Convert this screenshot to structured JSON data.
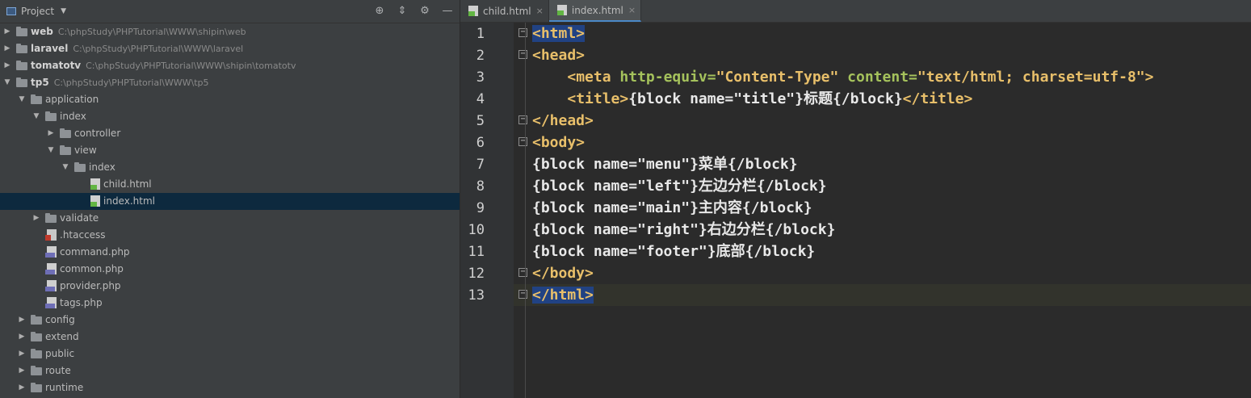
{
  "project": {
    "title": "Project",
    "tree": [
      {
        "label": "web",
        "path": "C:\\phpStudy\\PHPTutorial\\WWW\\shipin\\web",
        "depth": 0,
        "kind": "folder",
        "expanded": false,
        "bold": true
      },
      {
        "label": "laravel",
        "path": "C:\\phpStudy\\PHPTutorial\\WWW\\laravel",
        "depth": 0,
        "kind": "folder",
        "expanded": false,
        "bold": true
      },
      {
        "label": "tomatotv",
        "path": "C:\\phpStudy\\PHPTutorial\\WWW\\shipin\\tomatotv",
        "depth": 0,
        "kind": "folder",
        "expanded": false,
        "bold": true
      },
      {
        "label": "tp5",
        "path": "C:\\phpStudy\\PHPTutorial\\WWW\\tp5",
        "depth": 0,
        "kind": "folder",
        "expanded": true,
        "bold": true
      },
      {
        "label": "application",
        "path": "",
        "depth": 1,
        "kind": "folder",
        "expanded": true
      },
      {
        "label": "index",
        "path": "",
        "depth": 2,
        "kind": "folder",
        "expanded": true
      },
      {
        "label": "controller",
        "path": "",
        "depth": 3,
        "kind": "folder",
        "expanded": false
      },
      {
        "label": "view",
        "path": "",
        "depth": 3,
        "kind": "folder",
        "expanded": true
      },
      {
        "label": "index",
        "path": "",
        "depth": 4,
        "kind": "folder",
        "expanded": true
      },
      {
        "label": "child.html",
        "path": "",
        "depth": 5,
        "kind": "html"
      },
      {
        "label": "index.html",
        "path": "",
        "depth": 5,
        "kind": "html",
        "selected": true
      },
      {
        "label": "validate",
        "path": "",
        "depth": 2,
        "kind": "folder",
        "expanded": false
      },
      {
        "label": ".htaccess",
        "path": "",
        "depth": 2,
        "kind": "ht"
      },
      {
        "label": "command.php",
        "path": "",
        "depth": 2,
        "kind": "php"
      },
      {
        "label": "common.php",
        "path": "",
        "depth": 2,
        "kind": "php"
      },
      {
        "label": "provider.php",
        "path": "",
        "depth": 2,
        "kind": "php"
      },
      {
        "label": "tags.php",
        "path": "",
        "depth": 2,
        "kind": "php"
      },
      {
        "label": "config",
        "path": "",
        "depth": 1,
        "kind": "folder",
        "expanded": false
      },
      {
        "label": "extend",
        "path": "",
        "depth": 1,
        "kind": "folder",
        "expanded": false
      },
      {
        "label": "public",
        "path": "",
        "depth": 1,
        "kind": "folder",
        "expanded": false
      },
      {
        "label": "route",
        "path": "",
        "depth": 1,
        "kind": "folder",
        "expanded": false
      },
      {
        "label": "runtime",
        "path": "",
        "depth": 1,
        "kind": "folder",
        "expanded": false
      }
    ]
  },
  "editor": {
    "tabs": [
      {
        "label": "child.html",
        "active": false
      },
      {
        "label": "index.html",
        "active": true
      }
    ],
    "current_line": 13,
    "lines": [
      {
        "n": "1",
        "fold": true,
        "segments": [
          {
            "c": "sel-tag",
            "t": "<html>"
          }
        ]
      },
      {
        "n": "2",
        "fold": true,
        "segments": [
          {
            "c": "tag",
            "t": "<head>"
          }
        ]
      },
      {
        "n": "3",
        "fold": false,
        "segments": [
          {
            "c": "plain",
            "t": "    "
          },
          {
            "c": "tag",
            "t": "<meta "
          },
          {
            "c": "val",
            "t": "http-equiv="
          },
          {
            "c": "tag",
            "t": "\"Content-Type\" "
          },
          {
            "c": "val",
            "t": "content="
          },
          {
            "c": "tag",
            "t": "\"text/html; charset=utf-8\""
          },
          {
            "c": "tag",
            "t": ">"
          }
        ]
      },
      {
        "n": "4",
        "fold": false,
        "segments": [
          {
            "c": "plain",
            "t": "    "
          },
          {
            "c": "tag",
            "t": "<title>"
          },
          {
            "c": "plain",
            "t": "{block name=\"title\"}标题{/block}"
          },
          {
            "c": "tag",
            "t": "</title>"
          }
        ]
      },
      {
        "n": "5",
        "fold": true,
        "segments": [
          {
            "c": "tag",
            "t": "</head>"
          }
        ]
      },
      {
        "n": "6",
        "fold": true,
        "segments": [
          {
            "c": "tag",
            "t": "<body>"
          }
        ]
      },
      {
        "n": "7",
        "fold": false,
        "segments": [
          {
            "c": "plain",
            "t": "{block name=\"menu\"}菜单{/block}"
          }
        ]
      },
      {
        "n": "8",
        "fold": false,
        "segments": [
          {
            "c": "plain",
            "t": "{block name=\"left\"}左边分栏{/block}"
          }
        ]
      },
      {
        "n": "9",
        "fold": false,
        "segments": [
          {
            "c": "plain",
            "t": "{block name=\"main\"}主内容{/block}"
          }
        ]
      },
      {
        "n": "10",
        "fold": false,
        "segments": [
          {
            "c": "plain",
            "t": "{block name=\"right\"}右边分栏{/block}"
          }
        ]
      },
      {
        "n": "11",
        "fold": false,
        "segments": [
          {
            "c": "plain",
            "t": "{block name=\"footer\"}底部{/block}"
          }
        ]
      },
      {
        "n": "12",
        "fold": true,
        "segments": [
          {
            "c": "tag",
            "t": "</body>"
          }
        ]
      },
      {
        "n": "13",
        "fold": true,
        "segments": [
          {
            "c": "sel-tag",
            "t": "</html>"
          }
        ]
      }
    ]
  }
}
